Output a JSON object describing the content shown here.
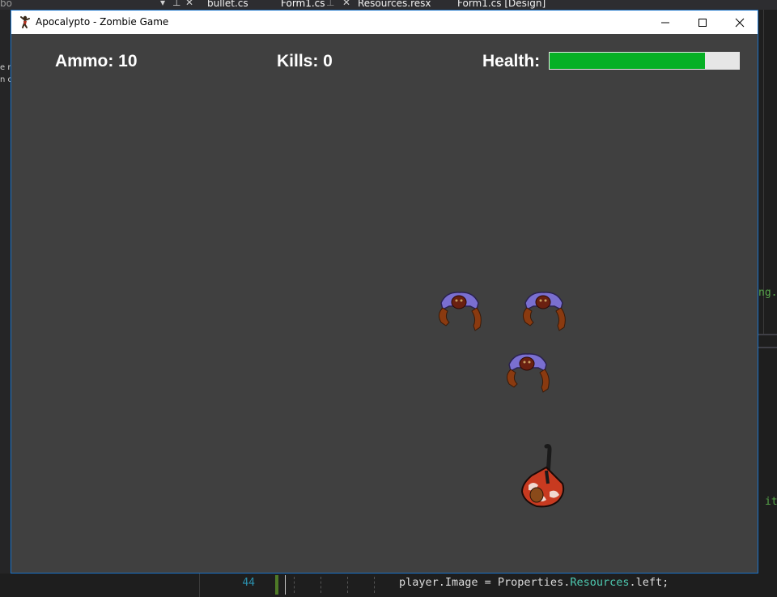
{
  "ide": {
    "tabs": [
      "bullet.cs",
      "Form1.cs",
      "Resources.resx",
      "Form1.cs [Design]"
    ],
    "left_fragment": "bo",
    "left_lines": [
      "e n",
      "n o"
    ],
    "right_lines": [
      "ng.",
      "it"
    ],
    "line_number": "44",
    "code": {
      "prefix": "player.Image = Properties.",
      "type": "Resources",
      "suffix": ".left;"
    }
  },
  "window": {
    "title": "Apocalypto - Zombie Game",
    "icon": "dancing-figure-icon",
    "controls": [
      "minimize-icon",
      "maximize-icon",
      "close-icon"
    ]
  },
  "hud": {
    "ammo_label": "Ammo: 10",
    "kills_label": "Kills: 0",
    "health_label": "Health:",
    "health_percent": 82
  },
  "colors": {
    "game_background": "#404040",
    "health_fill": "#06b025",
    "health_track": "#e6e6e6",
    "window_border": "#1a73c9"
  },
  "sprites": [
    "zombie",
    "zombie",
    "zombie",
    "player"
  ]
}
